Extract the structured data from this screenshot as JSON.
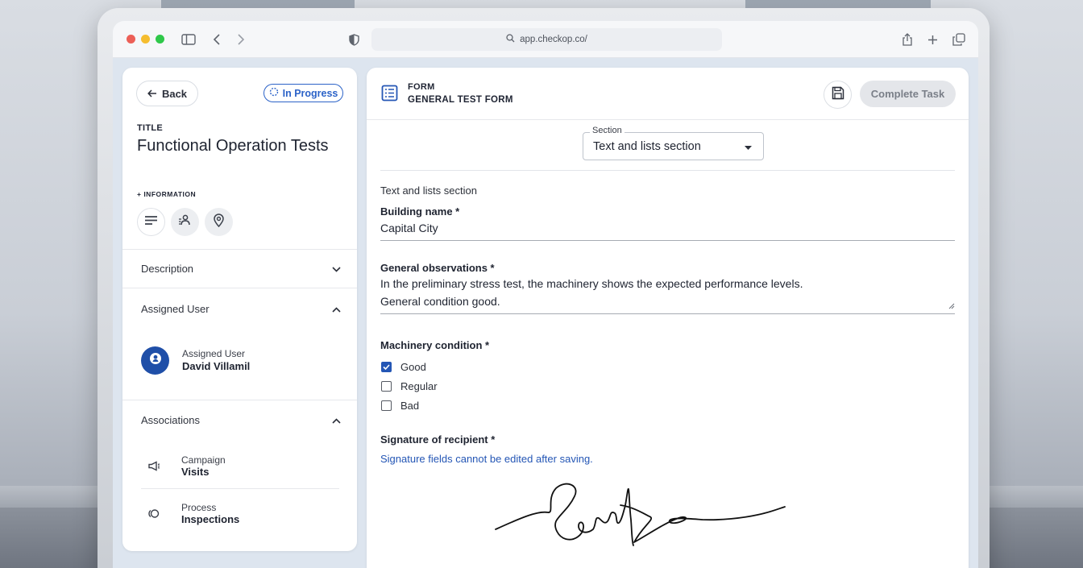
{
  "browser": {
    "url": "app.checkop.co/"
  },
  "left_panel": {
    "back_label": "Back",
    "status": "In Progress",
    "title_label": "TITLE",
    "title": "Functional Operation Tests",
    "info_label": "+ INFORMATION",
    "info_buttons": [
      "lines-icon",
      "user-list-icon",
      "location-pin-icon"
    ],
    "description_label": "Description",
    "assigned_user_header": "Assigned User",
    "assigned_user_label": "Assigned User",
    "assigned_user_name": "David Villamil",
    "associations_header": "Associations",
    "associations": [
      {
        "type": "Campaign",
        "name": "Visits",
        "icon": "megaphone-icon"
      },
      {
        "type": "Process",
        "name": "Inspections",
        "icon": "process-icon"
      }
    ]
  },
  "form": {
    "kind": "FORM",
    "name": "GENERAL TEST FORM",
    "complete_label": "Complete Task",
    "section_legend": "Section",
    "section_value": "Text and lists section",
    "section_heading": "Text and lists section",
    "building_label": "Building name *",
    "building_value": "Capital City",
    "observations_label": "General observations *",
    "observations_line1": "In the preliminary stress test, the machinery shows the expected performance levels.",
    "observations_line2": "General condition good.",
    "machinery_label": "Machinery condition *",
    "machinery_options": [
      {
        "label": "Good",
        "checked": true
      },
      {
        "label": "Regular",
        "checked": false
      },
      {
        "label": "Bad",
        "checked": false
      }
    ],
    "signature_label": "Signature of recipient *",
    "signature_note": "Signature fields cannot be edited after saving."
  },
  "colors": {
    "accent": "#2456b5",
    "status": "#2c63c8",
    "traffic_red": "#ec5f57",
    "traffic_yellow": "#f5bd2f",
    "traffic_green": "#2fc84a"
  }
}
